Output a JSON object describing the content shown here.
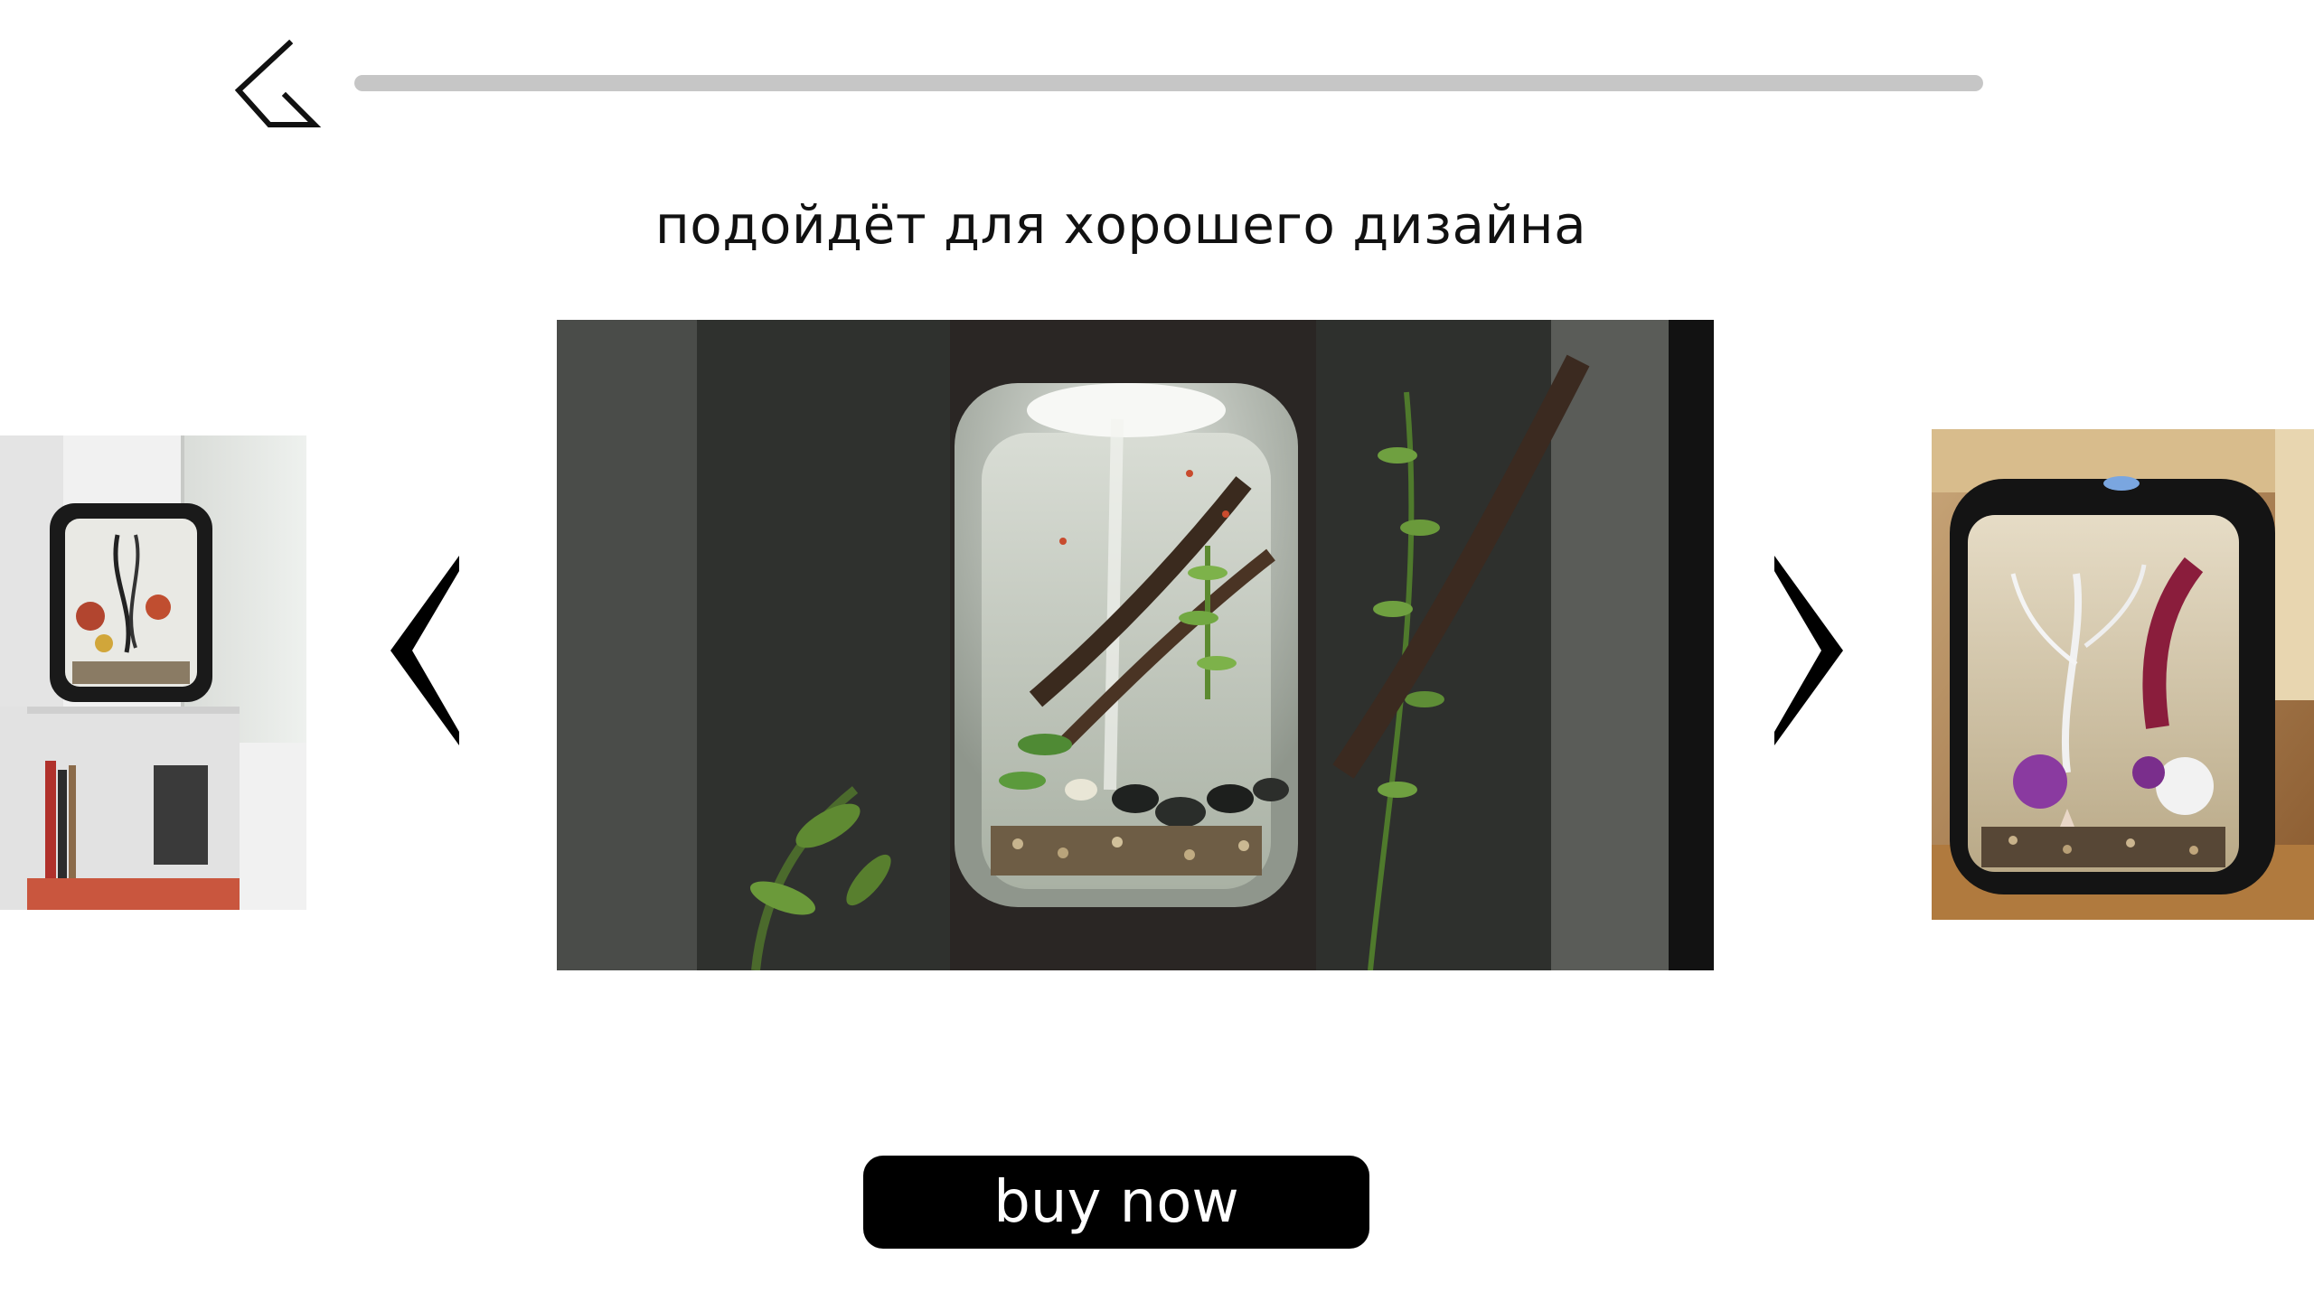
{
  "header": {
    "back_icon": "back-chevron-icon",
    "progress": {
      "percent": 100
    }
  },
  "main": {
    "title": "подойдёт для хорошего дизайна",
    "carousel": {
      "prev_icon": "chevron-left-icon",
      "next_icon": "chevron-right-icon",
      "slides": [
        {
          "name": "aquarium-photo-white-shelf",
          "position": "previous"
        },
        {
          "name": "aquarium-photo-driftwood-lit",
          "position": "current"
        },
        {
          "name": "aquarium-photo-black-coral",
          "position": "next"
        }
      ]
    }
  },
  "footer": {
    "buy_label": "buy now"
  },
  "colors": {
    "background": "#ffffff",
    "button": "#000000",
    "button_text": "#ffffff",
    "progress_fill": "#c6c6c6",
    "progress_track": "#e6e6e6"
  }
}
